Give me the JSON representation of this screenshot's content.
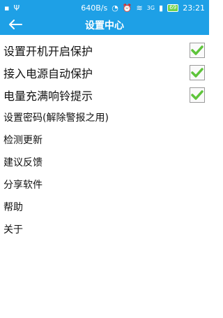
{
  "status_bar": {
    "speed": "640B/s",
    "network": "3G",
    "battery": "69",
    "time": "23:21",
    "icons": [
      "notification-icon",
      "usb-icon",
      "clock-icon",
      "alarm-icon",
      "wifi-icon",
      "signal-icon",
      "battery-icon"
    ]
  },
  "app_bar": {
    "title": "设置中心",
    "back_icon": "arrow-left-icon"
  },
  "settings": {
    "items": [
      {
        "label": "设置开机开启保护",
        "checked": true
      },
      {
        "label": "接入电源自动保护",
        "checked": true
      },
      {
        "label": "电量充满响铃提示",
        "checked": true
      },
      {
        "label": "设置密码(解除警报之用)"
      },
      {
        "label": "检测更新"
      },
      {
        "label": "建议反馈"
      },
      {
        "label": "分享软件"
      },
      {
        "label": "帮助"
      },
      {
        "label": "关于"
      }
    ]
  },
  "colors": {
    "accent": "#1ea0e6",
    "check_green": "#5ec43a"
  }
}
